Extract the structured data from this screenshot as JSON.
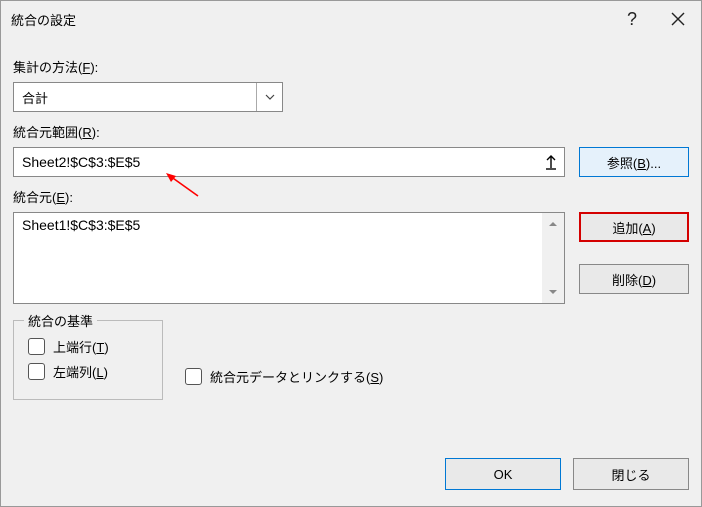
{
  "title": "統合の設定",
  "labels": {
    "function": "集計の方法",
    "function_key": "F",
    "reference": "統合元範囲",
    "reference_key": "R",
    "sources": "統合元",
    "sources_key": "E",
    "criteria_group": "統合の基準",
    "top_row": "上端行",
    "top_row_key": "T",
    "left_col": "左端列",
    "left_col_key": "L",
    "link_src": "統合元データとリンクする",
    "link_src_key": "S"
  },
  "function_value": "合計",
  "reference_value": "Sheet2!$C$3:$E$5",
  "sources_list": [
    "Sheet1!$C$3:$E$5"
  ],
  "buttons": {
    "browse": "参照",
    "browse_key": "B",
    "add": "追加",
    "add_key": "A",
    "delete": "削除",
    "delete_key": "D",
    "ok": "OK",
    "close": "閉じる"
  }
}
